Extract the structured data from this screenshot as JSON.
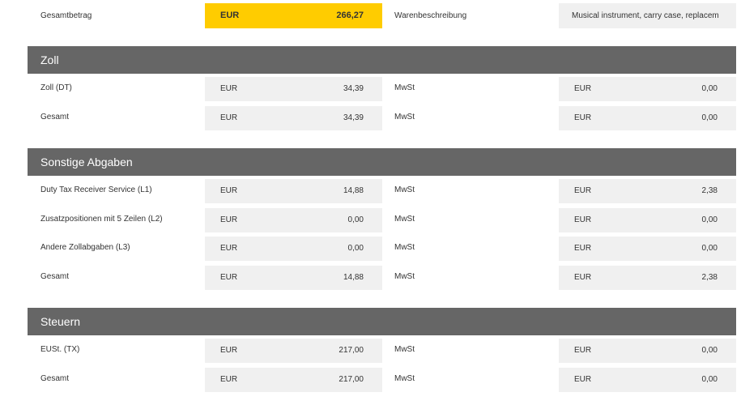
{
  "summary": {
    "total_label": "Gesamtbetrag",
    "total_currency": "EUR",
    "total_value": "266,27",
    "description_label": "Warenbeschreibung",
    "description_value": "Musical instrument, carry case, replacem"
  },
  "colors": {
    "highlight": "#ffcc00",
    "section_header": "#666666",
    "field_background": "#f0f0f0"
  },
  "sections": [
    {
      "title": "Zoll",
      "rows": [
        {
          "label": "Zoll (DT)",
          "currency": "EUR",
          "amount": "34,39",
          "vat_label": "MwSt",
          "vat_currency": "EUR",
          "vat_amount": "0,00"
        },
        {
          "label": "Gesamt",
          "currency": "EUR",
          "amount": "34,39",
          "vat_label": "MwSt",
          "vat_currency": "EUR",
          "vat_amount": "0,00"
        }
      ]
    },
    {
      "title": "Sonstige Abgaben",
      "rows": [
        {
          "label": "Duty Tax Receiver Service (L1)",
          "currency": "EUR",
          "amount": "14,88",
          "vat_label": "MwSt",
          "vat_currency": "EUR",
          "vat_amount": "2,38"
        },
        {
          "label": "Zusatzpositionen mit 5 Zeilen (L2)",
          "currency": "EUR",
          "amount": "0,00",
          "vat_label": "MwSt",
          "vat_currency": "EUR",
          "vat_amount": "0,00"
        },
        {
          "label": "Andere Zollabgaben (L3)",
          "currency": "EUR",
          "amount": "0,00",
          "vat_label": "MwSt",
          "vat_currency": "EUR",
          "vat_amount": "0,00"
        },
        {
          "label": "Gesamt",
          "currency": "EUR",
          "amount": "14,88",
          "vat_label": "MwSt",
          "vat_currency": "EUR",
          "vat_amount": "2,38"
        }
      ]
    },
    {
      "title": "Steuern",
      "rows": [
        {
          "label": "EUSt. (TX)",
          "currency": "EUR",
          "amount": "217,00",
          "vat_label": "MwSt",
          "vat_currency": "EUR",
          "vat_amount": "0,00"
        },
        {
          "label": "Gesamt",
          "currency": "EUR",
          "amount": "217,00",
          "vat_label": "MwSt",
          "vat_currency": "EUR",
          "vat_amount": "0,00"
        }
      ]
    }
  ]
}
